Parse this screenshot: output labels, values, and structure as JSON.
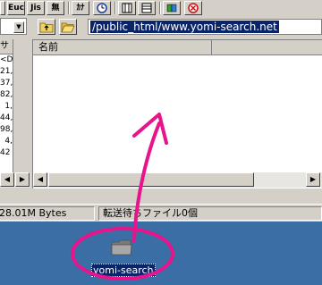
{
  "toolbar": {
    "buttons": [
      {
        "name": "euc-button",
        "label": "Euc"
      },
      {
        "name": "jis-button",
        "label": "Jis"
      },
      {
        "name": "kanji-none-button",
        "label": "無"
      },
      {
        "name": "kana-button",
        "label": "ｶﾅ"
      }
    ],
    "icons": [
      "clock-icon",
      "list-view-icon",
      "detail-view-icon",
      "sync-icon",
      "stop-icon"
    ]
  },
  "path": {
    "value": "/public_html/www.yomi-search.net"
  },
  "left_pane": {
    "header": "サ",
    "rows": [
      "<D",
      "21,",
      "37,",
      "82,",
      "1,",
      "44,",
      "98,",
      "4,",
      "",
      "42"
    ]
  },
  "right_pane": {
    "column_header": "名前"
  },
  "status": {
    "left": "28.01M Bytes",
    "right": "転送待ちファイル0個"
  },
  "desktop": {
    "folder_label": "yomi-search"
  },
  "annotation": {
    "color": "#e8148c"
  }
}
